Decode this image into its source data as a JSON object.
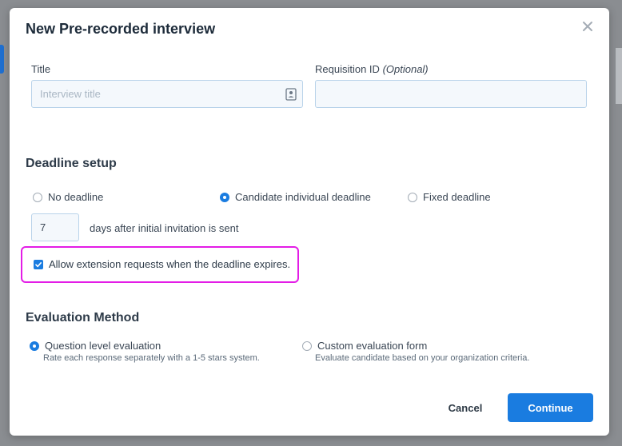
{
  "modal": {
    "title": "New Pre-recorded interview"
  },
  "form": {
    "title_label": "Title",
    "title_placeholder": "Interview title",
    "title_value": "",
    "requisition_label": "Requisition ID",
    "requisition_optional": "(Optional)",
    "requisition_value": ""
  },
  "deadline": {
    "section_title": "Deadline setup",
    "options": [
      {
        "label": "No deadline",
        "checked": false
      },
      {
        "label": "Candidate individual deadline",
        "checked": true
      },
      {
        "label": "Fixed deadline",
        "checked": false
      }
    ],
    "days_value": "7",
    "days_suffix": "days after initial invitation is sent",
    "extension_label": "Allow extension requests when the deadline expires.",
    "extension_checked": true
  },
  "evaluation": {
    "section_title": "Evaluation Method",
    "options": [
      {
        "label": "Question level evaluation",
        "hint": "Rate each response separately with a 1-5 stars system.",
        "checked": true
      },
      {
        "label": "Custom evaluation form",
        "hint": "Evaluate candidate based on your organization criteria.",
        "checked": false
      }
    ]
  },
  "footer": {
    "cancel_label": "Cancel",
    "continue_label": "Continue"
  },
  "colors": {
    "accent": "#1a7ce0",
    "highlight": "#e31de6"
  }
}
